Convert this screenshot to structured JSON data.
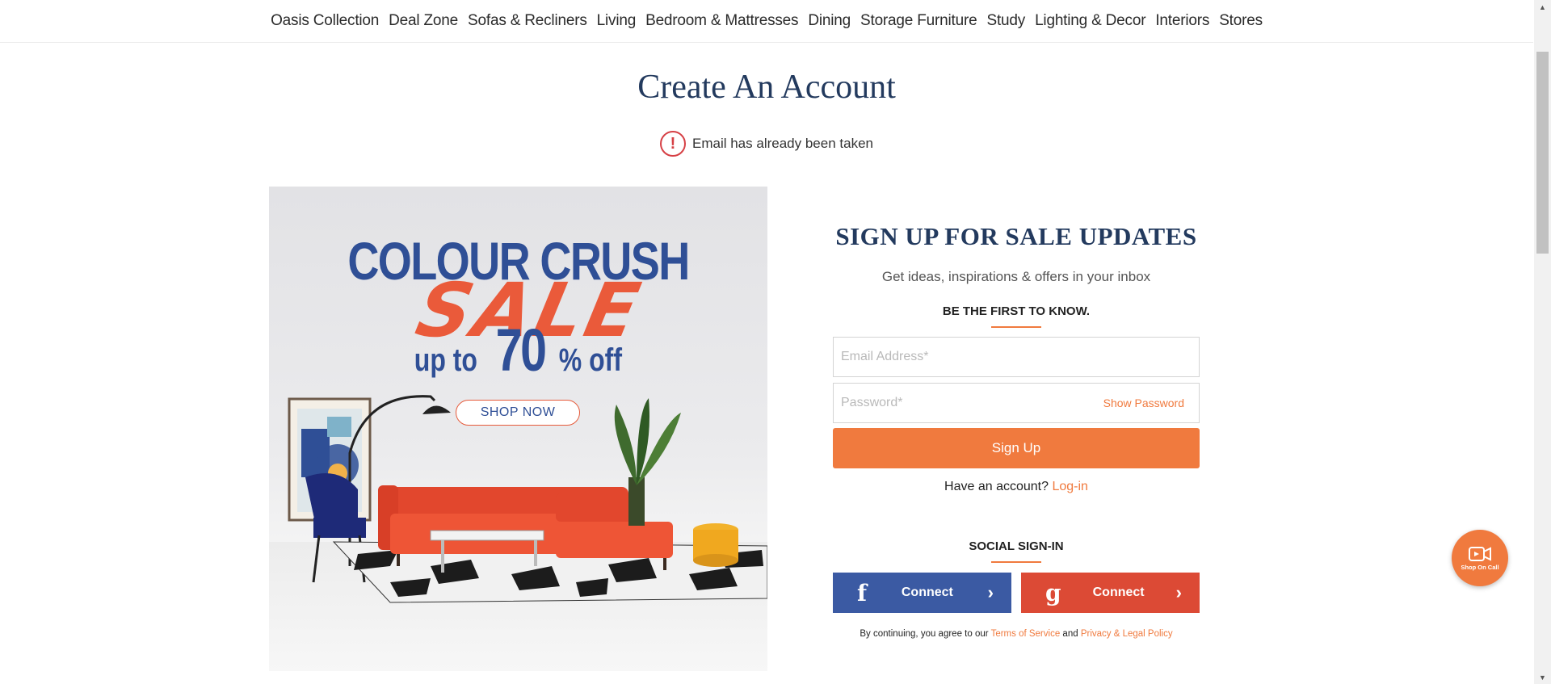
{
  "nav": {
    "items": [
      {
        "label": "Oasis Collection"
      },
      {
        "label": "Deal Zone"
      },
      {
        "label": "Sofas & Recliners"
      },
      {
        "label": "Living"
      },
      {
        "label": "Bedroom & Mattresses"
      },
      {
        "label": "Dining"
      },
      {
        "label": "Storage Furniture"
      },
      {
        "label": "Study"
      },
      {
        "label": "Lighting & Decor"
      },
      {
        "label": "Interiors"
      },
      {
        "label": "Stores"
      }
    ]
  },
  "page": {
    "title": "Create An Account",
    "error_message": "Email has already been taken",
    "error_icon": "!"
  },
  "banner": {
    "headline": "COLOUR CRUSH",
    "sale": "SALE",
    "upto_prefix": "up to",
    "upto_value": "70",
    "upto_suffix": "% off",
    "cta": "SHOP NOW"
  },
  "form": {
    "title": "SIGN UP FOR SALE UPDATES",
    "subtitle": "Get ideas, inspirations & offers in your inbox",
    "kicker": "BE THE FIRST TO KNOW.",
    "email_placeholder": "Email Address*",
    "email_value": "",
    "password_placeholder": "Password*",
    "password_value": "",
    "show_password": "Show Password",
    "submit": "Sign Up",
    "have_account": "Have an account?",
    "login_link": "Log-in",
    "social_title": "SOCIAL SIGN-IN",
    "facebook_glyph": "f",
    "facebook_label": "Connect",
    "google_glyph": "g",
    "google_label": "Connect",
    "chevron": "›",
    "terms_prefix": "By continuing, you agree to our",
    "terms_link": "Terms of Service",
    "terms_and": "and",
    "privacy_link": "Privacy & Legal Policy"
  },
  "shop_on_call": {
    "label": "Shop On Call",
    "icon": "video-camera-icon"
  },
  "colors": {
    "accent": "#f07a3e",
    "navy": "#233a5e",
    "facebook": "#3b5aa3",
    "google": "#dc4a35",
    "error": "#d64045"
  }
}
